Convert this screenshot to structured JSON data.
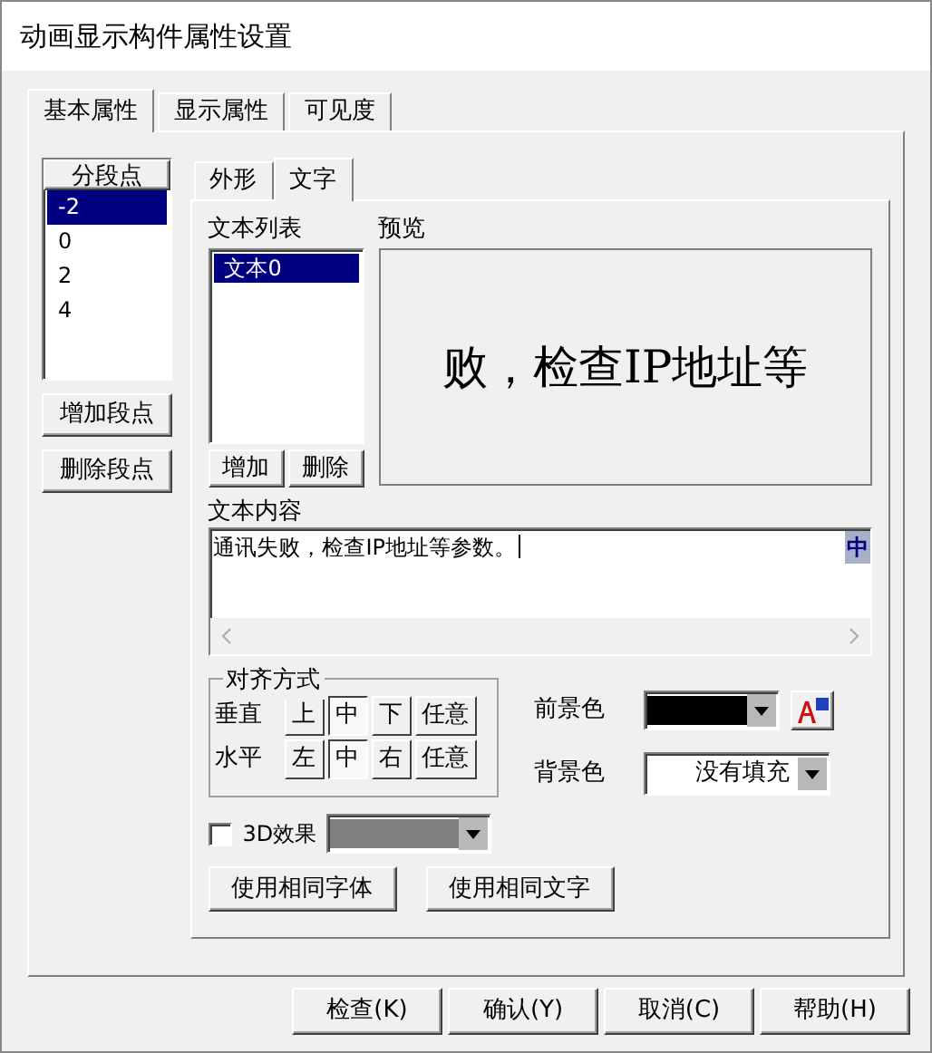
{
  "window": {
    "title": "动画显示构件属性设置"
  },
  "tabs": [
    {
      "label": "基本属性",
      "selected": true
    },
    {
      "label": "显示属性",
      "selected": false
    },
    {
      "label": "可见度",
      "selected": false
    }
  ],
  "segments": {
    "header": "分段点",
    "items": [
      {
        "label": "-2",
        "selected": true
      },
      {
        "label": "0",
        "selected": false
      },
      {
        "label": "2",
        "selected": false
      },
      {
        "label": "4",
        "selected": false
      }
    ],
    "buttons": [
      "增加段点",
      "删除段点"
    ]
  },
  "inner_tabs": [
    {
      "label": "外形",
      "selected": false
    },
    {
      "label": "文字",
      "selected": true
    }
  ],
  "text_list": {
    "label": "文本列表",
    "items": [
      {
        "label": "文本0",
        "selected": true
      }
    ],
    "buttons": [
      "增加",
      "删除"
    ]
  },
  "preview": {
    "label": "预览",
    "text": "败，检查IP地址等"
  },
  "text_content": {
    "label": "文本内容",
    "value": "通讯失败，检查IP地址等参数。",
    "ime_indicator": "中"
  },
  "alignment": {
    "title": "对齐方式",
    "rows": [
      {
        "label": "垂直",
        "options": [
          {
            "label": "上",
            "selected": false
          },
          {
            "label": "中",
            "selected": true
          },
          {
            "label": "下",
            "selected": false
          },
          {
            "label": "任意",
            "selected": false
          }
        ]
      },
      {
        "label": "水平",
        "options": [
          {
            "label": "左",
            "selected": false
          },
          {
            "label": "中",
            "selected": true
          },
          {
            "label": "右",
            "selected": false
          },
          {
            "label": "任意",
            "selected": false
          }
        ]
      }
    ]
  },
  "foreground": {
    "label": "前景色",
    "color": "#000000"
  },
  "background": {
    "label": "背景色",
    "value": "没有填充"
  },
  "effect_3d": {
    "label": "3D效果",
    "checked": false,
    "color": "#808080"
  },
  "same_buttons": [
    "使用相同字体",
    "使用相同文字"
  ],
  "footer_buttons": [
    "检查(K)",
    "确认(Y)",
    "取消(C)",
    "帮助(H)"
  ]
}
